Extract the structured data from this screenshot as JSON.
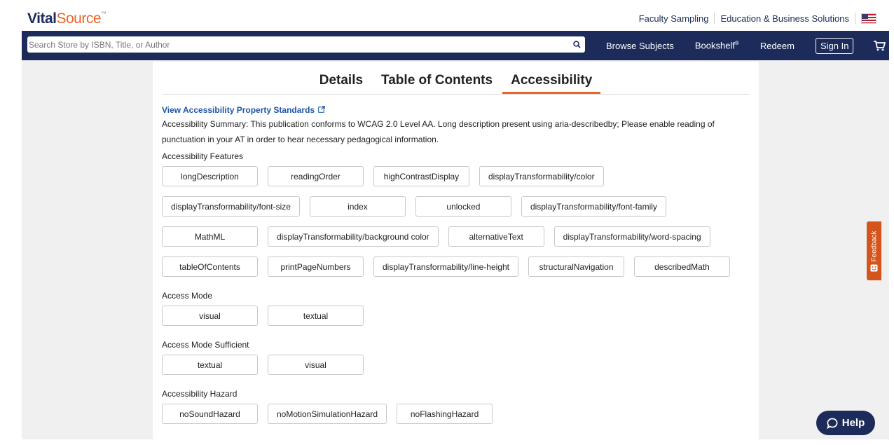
{
  "brand": {
    "vital": "Vital",
    "source": "Source",
    "tm": "™"
  },
  "top_links": {
    "faculty": "Faculty Sampling",
    "education": "Education & Business Solutions"
  },
  "search": {
    "placeholder": "Search Store by ISBN, Title, or Author"
  },
  "nav": {
    "browse": "Browse Subjects",
    "bookshelf": "Bookshelf",
    "bookshelf_mark": "®",
    "redeem": "Redeem",
    "signin": "Sign In"
  },
  "tabs": [
    {
      "label": "Details"
    },
    {
      "label": "Table of Contents"
    },
    {
      "label": "Accessibility",
      "active": true
    }
  ],
  "accessibility": {
    "standards_link": "View Accessibility Property Standards",
    "summary": "Accessibility Summary: This publication conforms to WCAG 2.0 Level AA. Long description present using aria-describedby; Please enable reading of punctuation in your AT in order to hear necessary pedagogical information.",
    "features_label": "Accessibility Features",
    "features": [
      "longDescription",
      "readingOrder",
      "highContrastDisplay",
      "displayTransformability/color",
      "displayTransformability/font-size",
      "index",
      "unlocked",
      "displayTransformability/font-family",
      "MathML",
      "displayTransformability/background color",
      "alternativeText",
      "displayTransformability/word-spacing",
      "tableOfContents",
      "printPageNumbers",
      "displayTransformability/line-height",
      "structuralNavigation",
      "describedMath"
    ],
    "access_mode_label": "Access Mode",
    "access_mode": [
      "visual",
      "textual"
    ],
    "access_mode_sufficient_label": "Access Mode Sufficient",
    "access_mode_sufficient": [
      "textual",
      "visual"
    ],
    "hazard_label": "Accessibility Hazard",
    "hazards": [
      "noSoundHazard",
      "noMotionSimulationHazard",
      "noFlashingHazard"
    ]
  },
  "feedback": {
    "label": "Feedback"
  },
  "help": {
    "label": "Help"
  },
  "colors": {
    "navy": "#1c2b5a",
    "orange": "#e8642b",
    "link": "#1c55a6",
    "feedback": "#d4541b"
  }
}
